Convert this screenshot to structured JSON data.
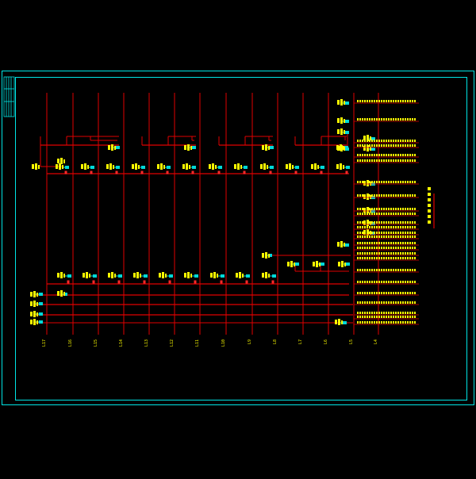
{
  "colors": {
    "background": "#000000",
    "frame": "#00e5e5",
    "riser": "#e00000",
    "branch": "#e00000",
    "valve": "#00d8d8",
    "label": "#ffff00",
    "marker": "#ff2a2a"
  },
  "riser_labels": [
    "L17",
    "L16",
    "L15",
    "L14",
    "L13",
    "L12",
    "L11",
    "L10",
    "L9",
    "L8",
    "L7",
    "L6",
    "L5",
    "L4"
  ],
  "title_vertical": "",
  "notes": []
}
